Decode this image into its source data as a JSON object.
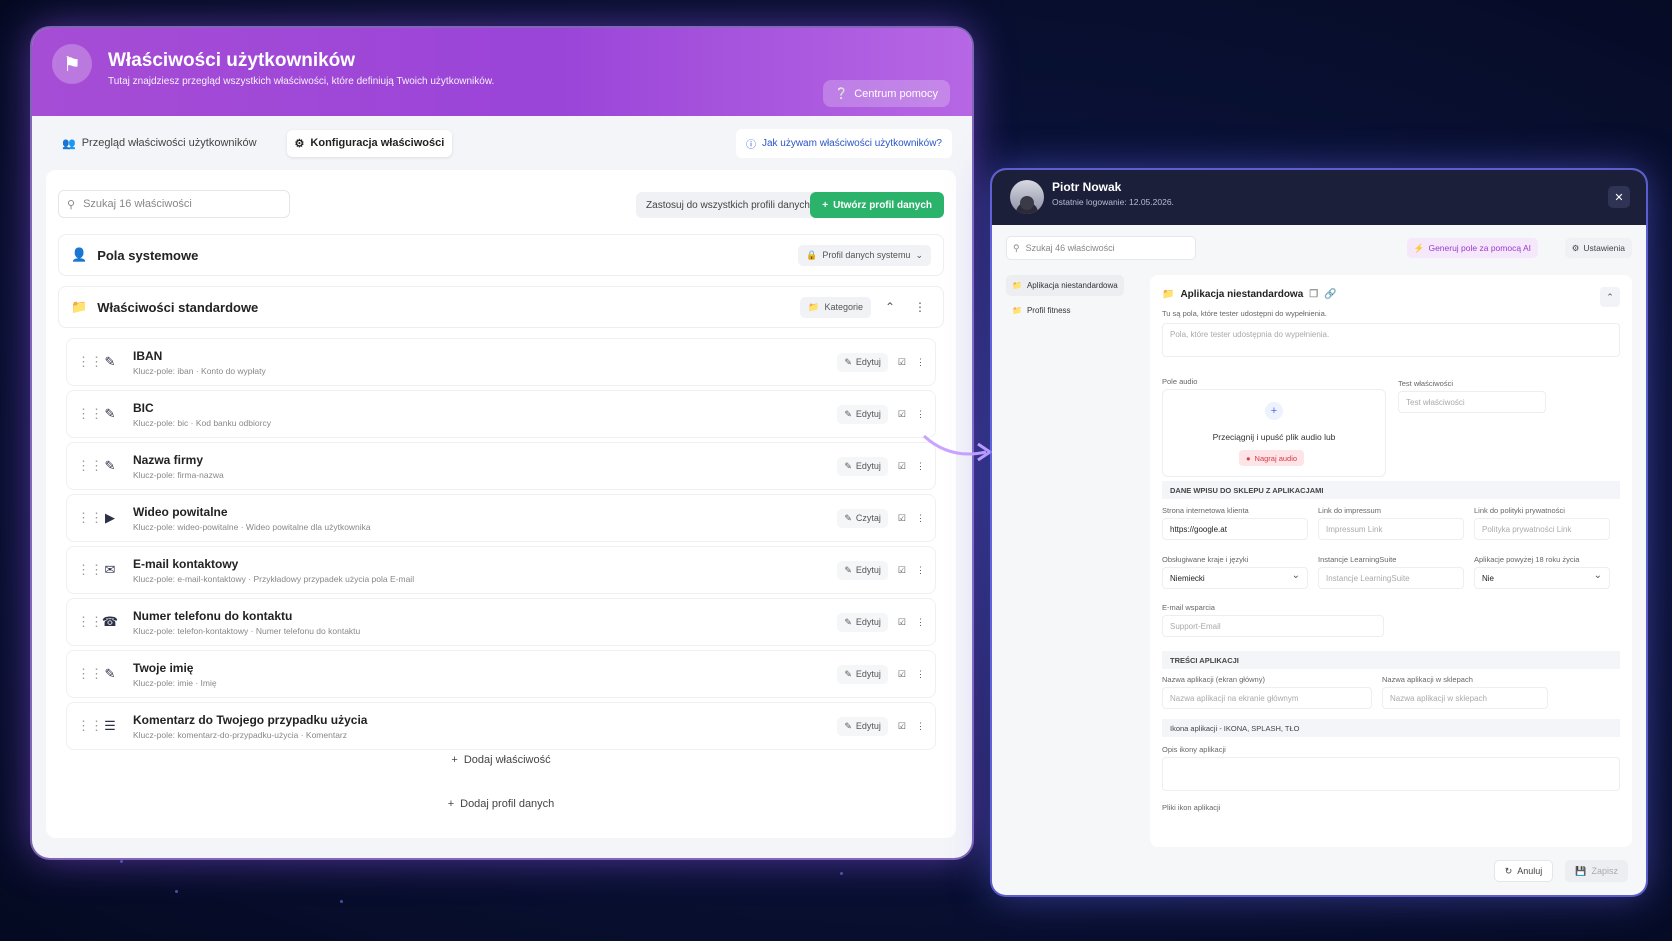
{
  "left": {
    "header": {
      "title": "Właściwości użytkowników",
      "subtitle": "Tutaj znajdziesz przegląd wszystkich właściwości, które definiują Twoich użytkowników.",
      "help_button": "Centrum pomocy"
    },
    "tabs": [
      {
        "label": "Przegląd właściwości użytkowników",
        "icon": "users-icon"
      },
      {
        "label": "Konfiguracja właściwości",
        "icon": "gear-icon"
      }
    ],
    "help_link": "Jak używam właściwości użytkowników?",
    "search_placeholder": "Szukaj 16 właściwości",
    "apply_all_button": "Zastosuj do wszystkich profili danych",
    "create_profile_button": "Utwórz profil danych",
    "system_section": {
      "title": "Pola systemowe",
      "profile_label": "Profil danych systemu"
    },
    "standard_section": {
      "title": "Właściwości standardowe",
      "categories_label": "Kategorie"
    },
    "rows": [
      {
        "title": "IBAN",
        "meta": "Klucz-pole: iban  ·  Konto do wypłaty",
        "action": "Edytuj",
        "icon": "edit-icon"
      },
      {
        "title": "BIC",
        "meta": "Klucz-pole: bic  ·  Kod banku odbiorcy",
        "action": "Edytuj",
        "icon": "edit-icon"
      },
      {
        "title": "Nazwa firmy",
        "meta": "Klucz-pole: firma-nazwa",
        "action": "Edytuj",
        "icon": "edit-icon"
      },
      {
        "title": "Wideo powitalne",
        "meta": "Klucz-pole: wideo-powitalne  ·  Wideo powitalne dla użytkownika",
        "action": "Czytaj",
        "icon": "video-icon"
      },
      {
        "title": "E-mail kontaktowy",
        "meta": "Klucz-pole: e-mail-kontaktowy  ·  Przykładowy przypadek użycia pola E-mail",
        "action": "Edytuj",
        "icon": "mail-icon"
      },
      {
        "title": "Numer telefonu do kontaktu",
        "meta": "Klucz-pole: telefon-kontaktowy  ·  Numer telefonu do kontaktu",
        "action": "Edytuj",
        "icon": "phone-icon"
      },
      {
        "title": "Twoje imię",
        "meta": "Klucz-pole: imie  ·  Imię",
        "action": "Edytuj",
        "icon": "edit-icon"
      },
      {
        "title": "Komentarz do Twojego przypadku użycia",
        "meta": "Klucz-pole: komentarz-do-przypadku-użycia  ·  Komentarz",
        "action": "Edytuj",
        "icon": "text-icon"
      }
    ],
    "add_property": "Dodaj właściwość",
    "add_profile": "Dodaj profil danych"
  },
  "right": {
    "user_name": "Piotr Nowak",
    "last_login": "Ostatnie logowanie: 12.05.2026.",
    "search_placeholder": "Szukaj 46 właściwości",
    "ai_button": "Generuj pole za pomocą AI",
    "settings_button": "Ustawienia",
    "sidebar": [
      "Aplikacja niestandardowa",
      "Profil fitness"
    ],
    "main": {
      "title": "Aplikacja niestandardowa",
      "hint": "Tu są pola, które tester udostępni do wypełnienia.",
      "textarea_placeholder": "Pola, które tester udostępnia do wypełnienia.",
      "audio_label": "Pole audio",
      "audio_text": "Przeciągnij i upuść plik audio lub",
      "record_button": "Nagraj audio",
      "test_label": "Test właściwości",
      "test_placeholder": "Test właściwości",
      "band1": "DANE WPISU DO SKLEPU Z APLIKACJAMI",
      "website_label": "Strona internetowa klienta",
      "website_value": "https://google.at",
      "impressum_label": "Link do impressum",
      "impressum_placeholder": "Impressum Link",
      "privacy_label": "Link do polityki prywatności",
      "privacy_placeholder": "Polityka prywatności Link",
      "countries_label": "Obsługiwane kraje i języki",
      "countries_value": "Niemiecki",
      "ls_label": "Instancje LearningSuite",
      "ls_placeholder": "Instancje LearningSuite",
      "age_label": "Aplikacje powyżej 18 roku życia",
      "age_value": "Nie",
      "support_label": "E-mail wsparcia",
      "support_placeholder": "Support-Email",
      "band2": "TREŚCI APLIKACJI",
      "appname_home_label": "Nazwa aplikacji (ekran główny)",
      "appname_home_placeholder": "Nazwa aplikacji na ekranie głównym",
      "appname_store_label": "Nazwa aplikacji w sklepach",
      "appname_store_placeholder": "Nazwa aplikacji w sklepach",
      "band3": "Ikona aplikacji - IKONA, SPLASH, TŁO",
      "icon_desc_label": "Opis ikony aplikacji",
      "icon_files_label": "Pliki ikon aplikacji"
    },
    "cancel_button": "Anuluj",
    "save_button": "Zapisz"
  }
}
